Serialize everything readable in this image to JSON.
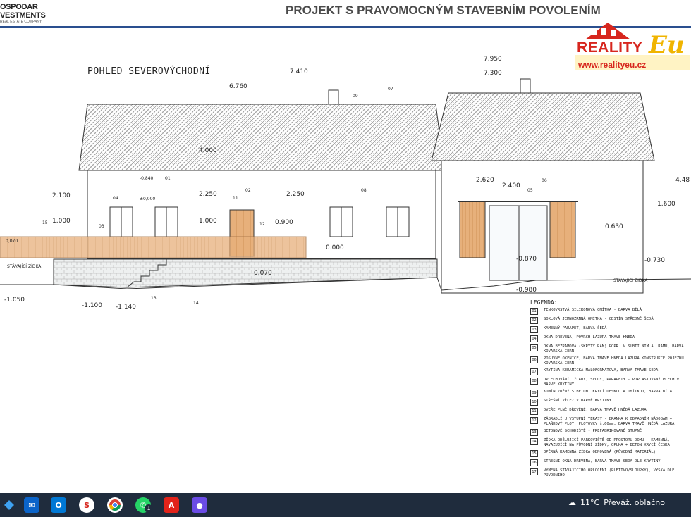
{
  "header": {
    "company_line1": "OSPODAR",
    "company_line2": "VESTMENTS",
    "company_line3": "REAL ESTATE COMPANY",
    "project_title": "PROJEKT S PRAVOMOCNÝM STAVEBNÍM POVOLENÍM"
  },
  "logo": {
    "brand": "REALITY",
    "brand_suffix": "Eu",
    "url": "www.realityeu.cz",
    "colors": {
      "red": "#d7261e",
      "gold": "#f0b400"
    }
  },
  "drawing": {
    "view_title": "POHLED SEVEROVÝCHODNÍ",
    "heights": [
      "6.760",
      "7.410",
      "7.950",
      "7.300",
      "4.000",
      "4.48",
      "2.100",
      "1.000",
      "2.250",
      "1.000",
      "2.250",
      "0.900",
      "2.620",
      "2.400",
      "1.600",
      "0.630",
      "0.000",
      "0.070",
      "-0.870",
      "-0.730",
      "-0.980",
      "-1.050",
      "-1.100",
      "-1.140"
    ],
    "small_labels": [
      "-0,840",
      "±0,000",
      "0,070"
    ],
    "tags": [
      "01",
      "02",
      "03",
      "04",
      "05",
      "06",
      "07",
      "08",
      "09",
      "11",
      "12",
      "13",
      "14",
      "15"
    ],
    "stary_zidka": "STÁVAJÍCÍ ZÍDKA"
  },
  "legend": {
    "title": "LEGENDA:",
    "items": [
      {
        "num": "01",
        "text": "TENKOVRSTVÁ SILIKONOVÁ OMÍTKA - BARVA BÍLÁ"
      },
      {
        "num": "02",
        "text": "SOKLOVÁ JEMNOZRNNÁ OMÍTKA - ODSTÍN STŘEDNĚ ŠEDÁ"
      },
      {
        "num": "03",
        "text": "KAMENNÝ PARAPET, BARVA ŠEDÁ"
      },
      {
        "num": "04",
        "text": "OKNA DŘEVĚNÁ, POVRCH LAZURA TMAVĚ HNĚDÁ"
      },
      {
        "num": "05",
        "text": "OKNA BEZRÁMOVÁ (SKRYTÝ RÁM) POPŘ. V SUBTILNÍM AL RÁMU, BARVA KOVÁŘSKÁ ČERŇ"
      },
      {
        "num": "06",
        "text": "POSUVNÉ OKENICE, BARVA TMAVĚ HNĚDÁ LAZURA KONSTRUKCE POJEZDU KOVÁŘSKÁ ČERŇ"
      },
      {
        "num": "07",
        "text": "KRYTINA KERAMICKÁ MALOFORMÁTOVÁ, BARVA TMAVĚ ŠEDÁ"
      },
      {
        "num": "08",
        "text": "OPLECHOVÁNÍ, ŽLABY, SVODY, PARAPETY - POPLASTOVANÝ PLECH V BARVĚ KRYTINY"
      },
      {
        "num": "09",
        "text": "KOMÍN ZDĚNÝ S BETON. KRYCÍ DESKOU A OMÍTKOU, BARVA BÍLÁ"
      },
      {
        "num": "10",
        "text": "STŘEŠNÍ VÝLEZ V BARVĚ KRYTINY"
      },
      {
        "num": "11",
        "text": "DVEŘE PLNÉ DŘEVĚNÉ, BARVA TMAVĚ HNĚDÁ LAZURA"
      },
      {
        "num": "12",
        "text": "ZÁBRADLÍ U VSTUPNÍ TERASY - BRANKA K ODPADNÍM NÁDOBÁM = PLAŇKOVÝ PLOT, PLOTOVKY š.60mm, BARVA TMAVĚ HNĚDÁ LAZURA"
      },
      {
        "num": "13",
        "text": "BETONOVÉ SCHODIŠTĚ - PREFABRIKOVANÉ STUPNĚ"
      },
      {
        "num": "14",
        "text": "ZÍDKA ODĚLUJÍCÍ PARKOVIŠTĚ OD PROSTORU DOMU - KAMENNÁ, NAVAZUJÍCÍ NA PŮVODNÍ ZÍDKY, OPUKA + BETON KRYCÍ ČESKA"
      },
      {
        "num": "15",
        "text": "OPĚRNÁ KAMENNÁ ZÍDKA OBNOVENÁ (PŮVODNÍ MATERIÁL)"
      },
      {
        "num": "16",
        "text": "STŘEŠNÍ OKNA DŘEVĚNÁ, BARVA TMAVĚ ŠEDÁ DLE KRYTINY"
      },
      {
        "num": "17",
        "text": "VÝMĚNA STÁVAJÍCÍHO OPLOCENÍ (PLETIVO/SLOUPKY), VÝŠKA DLE PŮVODNÍHO"
      }
    ]
  },
  "taskbar": {
    "icons": [
      "windows-start",
      "outlook",
      "slack",
      "chrome",
      "whatsapp",
      "acrobat",
      "paint"
    ],
    "whatsapp_badge": "1",
    "temperature": "11°C",
    "weather_text": "Převáž. oblačno"
  }
}
